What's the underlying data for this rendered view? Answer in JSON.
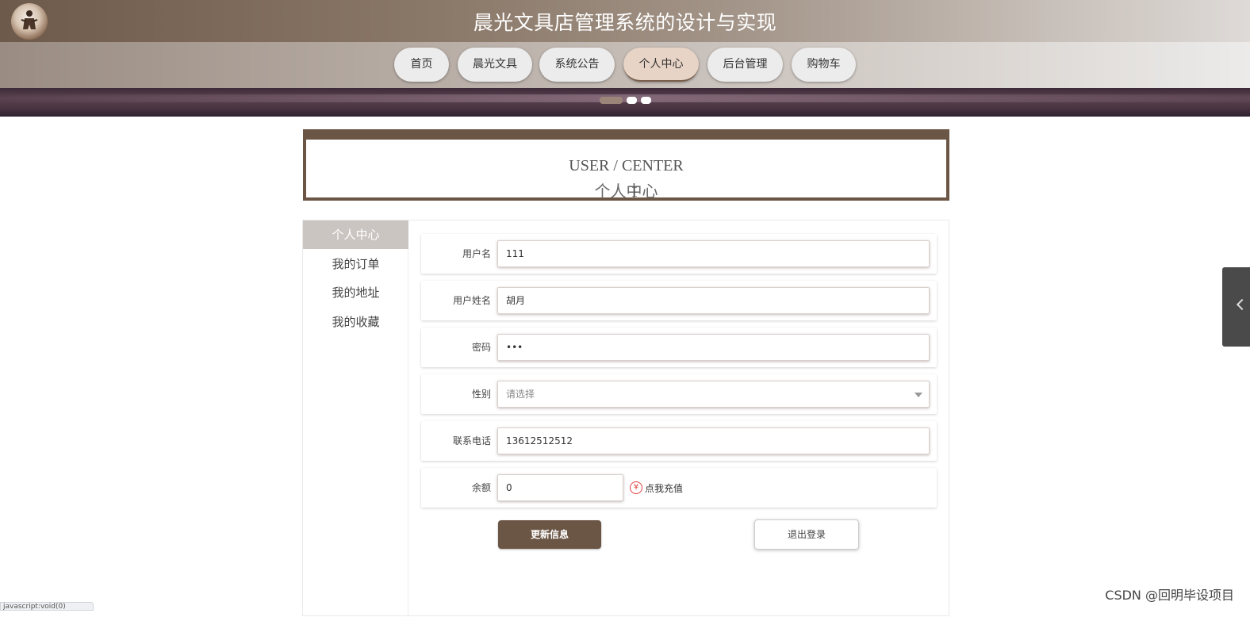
{
  "header": {
    "title": "晨光文具店管理系统的设计与实现"
  },
  "nav": {
    "items": [
      {
        "label": "首页"
      },
      {
        "label": "晨光文具"
      },
      {
        "label": "系统公告"
      },
      {
        "label": "个人中心"
      },
      {
        "label": "后台管理"
      },
      {
        "label": "购物车"
      }
    ],
    "active": "个人中心"
  },
  "banner": {
    "dots": 3,
    "active_dot": 1
  },
  "section": {
    "title_en": "USER / CENTER",
    "title_cn": "个人中心"
  },
  "sidemenu": {
    "items": [
      {
        "label": "个人中心"
      },
      {
        "label": "我的订单"
      },
      {
        "label": "我的地址"
      },
      {
        "label": "我的收藏"
      }
    ],
    "active": "个人中心"
  },
  "form": {
    "username": {
      "label": "用户名",
      "value": "111"
    },
    "fullname": {
      "label": "用户姓名",
      "value": "胡月"
    },
    "password": {
      "label": "密码",
      "value": "•••"
    },
    "gender": {
      "label": "性别",
      "placeholder": "请选择"
    },
    "phone": {
      "label": "联系电话",
      "value": "13612512512"
    },
    "balance": {
      "label": "余额",
      "value": "0",
      "recharge_icon": "¥",
      "recharge_label": "点我充值"
    }
  },
  "buttons": {
    "update": "更新信息",
    "logout": "退出登录"
  },
  "watermark": "CSDN @回明毕设项目",
  "status_bar": "javascript:void(0)",
  "colors": {
    "brand": "#6b5646",
    "nav_active": "#e8d4c6",
    "side_active": "#cbc5c2",
    "recharge_icon": "#e04040"
  }
}
